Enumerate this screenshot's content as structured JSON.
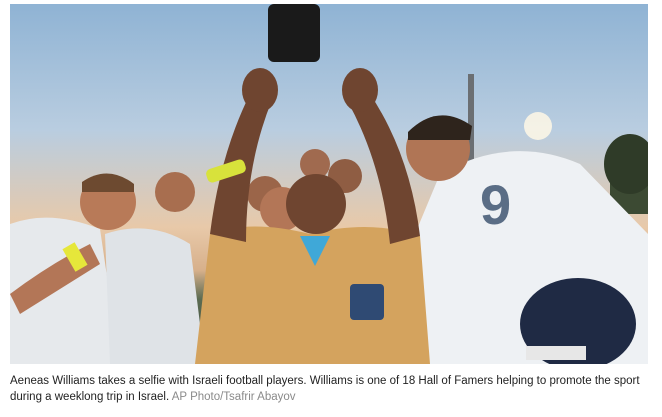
{
  "photo": {
    "alt_subject": "selfie-photo"
  },
  "caption": {
    "text": "Aeneas Williams takes a selfie with Israeli football players. Williams is one of 18 Hall of Famers helping to promote the sport during a weeklong trip in Israel.",
    "credit": "AP Photo/Tsafrir Abayov"
  },
  "colors": {
    "jacket": "#d4a35e",
    "jersey": "#e9ecef",
    "sky_top": "#8fb3d4",
    "sky_glow": "#e8c9a9"
  }
}
